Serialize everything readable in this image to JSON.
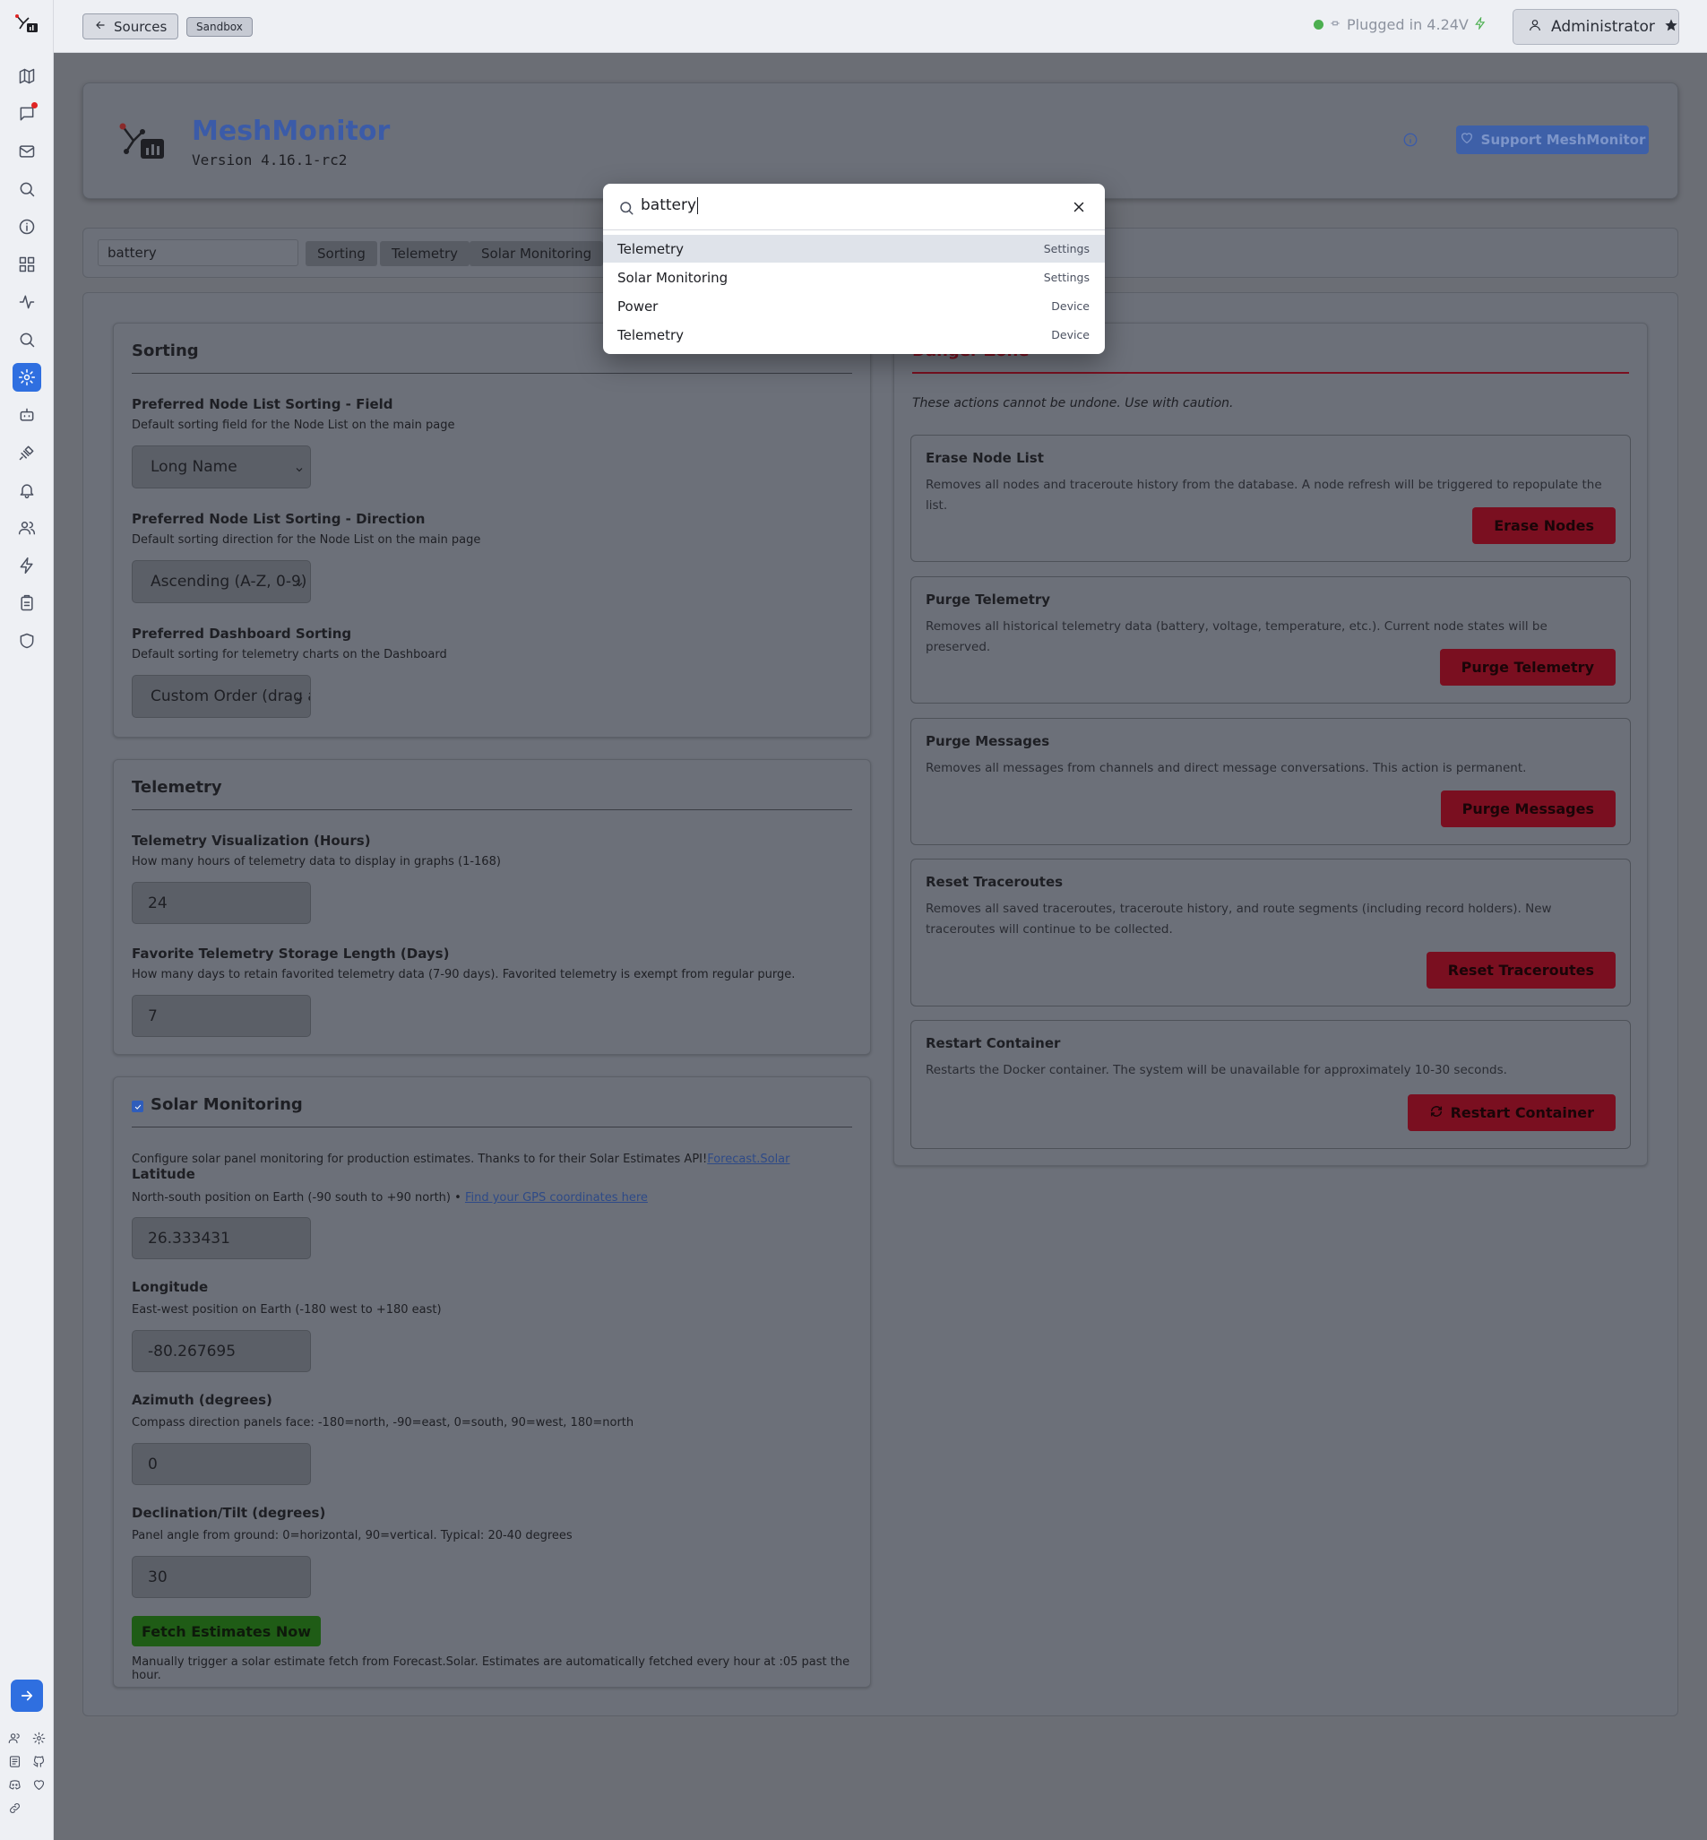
{
  "topbar": {
    "sources_label": "Sources",
    "sandbox_label": "Sandbox",
    "status_text": "Plugged in 4.24V",
    "user_label": "Administrator"
  },
  "header": {
    "title": "MeshMonitor",
    "version": "Version 4.16.1-rc2",
    "support_label": "Support MeshMonitor"
  },
  "filter": {
    "value": "battery",
    "chips": [
      "Sorting",
      "Telemetry",
      "Solar Monitoring"
    ]
  },
  "search": {
    "query": "battery",
    "results": [
      {
        "label": "Telemetry",
        "category": "Settings"
      },
      {
        "label": "Solar Monitoring",
        "category": "Settings"
      },
      {
        "label": "Power",
        "category": "Device"
      },
      {
        "label": "Telemetry",
        "category": "Device"
      }
    ]
  },
  "sorting": {
    "title": "Sorting",
    "field_label": "Preferred Node List Sorting - Field",
    "field_hint": "Default sorting field for the Node List on the main page",
    "field_value": "Long Name",
    "direction_label": "Preferred Node List Sorting - Direction",
    "direction_hint": "Default sorting direction for the Node List on the main page",
    "direction_value": "Ascending (A-Z, 0-9)",
    "dashboard_label": "Preferred Dashboard Sorting",
    "dashboard_hint": "Default sorting for telemetry charts on the Dashboard",
    "dashboard_value": "Custom Order (drag and drop)"
  },
  "telemetry": {
    "title": "Telemetry",
    "viz_label": "Telemetry Visualization (Hours)",
    "viz_hint": "How many hours of telemetry data to display in graphs (1-168)",
    "viz_value": "24",
    "fav_label": "Favorite Telemetry Storage Length (Days)",
    "fav_hint": "How many days to retain favorited telemetry data (7-90 days). Favorited telemetry is exempt from regular purge.",
    "fav_value": "7"
  },
  "solar": {
    "title": "Solar Monitoring",
    "intro": "Configure solar panel monitoring for production estimates. Thanks to for their Solar Estimates API!",
    "intro_link": "Forecast.Solar",
    "lat_label": "Latitude",
    "lat_hint": "North-south position on Earth (-90 south to +90 north) • ",
    "lat_link": "Find your GPS coordinates here",
    "lat_value": "26.333431",
    "lon_label": "Longitude",
    "lon_hint": "East-west position on Earth (-180 west to +180 east)",
    "lon_value": "-80.267695",
    "az_label": "Azimuth (degrees)",
    "az_hint": "Compass direction panels face: -180=north, -90=east, 0=south, 90=west, 180=north",
    "az_value": "0",
    "tilt_label": "Declination/Tilt (degrees)",
    "tilt_hint": "Panel angle from ground: 0=horizontal, 90=vertical. Typical: 20-40 degrees",
    "tilt_value": "30",
    "fetch_label": "Fetch Estimates Now",
    "fetch_hint": "Manually trigger a solar estimate fetch from Forecast.Solar. Estimates are automatically fetched every hour at :05 past the hour."
  },
  "danger": {
    "title": "Danger Zone",
    "note": "These actions cannot be undone. Use with caution.",
    "items": [
      {
        "title": "Erase Node List",
        "desc": "Removes all nodes and traceroute history from the database. A node refresh will be triggered to repopulate the list.",
        "button": "Erase Nodes"
      },
      {
        "title": "Purge Telemetry",
        "desc": "Removes all historical telemetry data (battery, voltage, temperature, etc.). Current node states will be preserved.",
        "button": "Purge Telemetry"
      },
      {
        "title": "Purge Messages",
        "desc": "Removes all messages from channels and direct message conversations. This action is permanent.",
        "button": "Purge Messages"
      },
      {
        "title": "Reset Traceroutes",
        "desc": "Removes all saved traceroutes, traceroute history, and route segments (including record holders). New traceroutes will continue to be collected.",
        "button": "Reset Traceroutes"
      },
      {
        "title": "Restart Container",
        "desc": "Restarts the Docker container. The system will be unavailable for approximately 10-30 seconds.",
        "button": "Restart Container"
      }
    ]
  }
}
